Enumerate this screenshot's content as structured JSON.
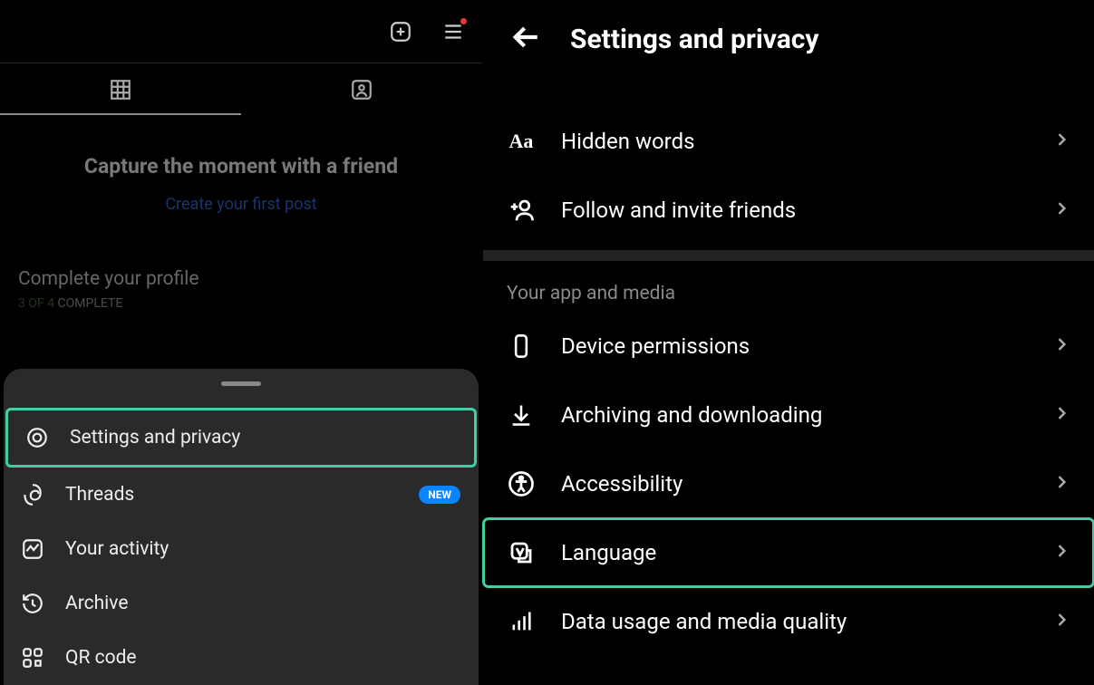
{
  "left": {
    "empty_title": "Capture the moment with a friend",
    "empty_link": "Create your first post",
    "complete_title": "Complete your profile",
    "complete_num": "3 OF 4",
    "complete_rest": " COMPLETE",
    "sheet_items": [
      {
        "label": "Settings and privacy"
      },
      {
        "label": "Threads"
      },
      {
        "label": "Your activity"
      },
      {
        "label": "Archive"
      },
      {
        "label": "QR code"
      }
    ],
    "badge_new": "NEW"
  },
  "right": {
    "header_title": "Settings and privacy",
    "top_rows": [
      {
        "label": "Hidden words"
      },
      {
        "label": "Follow and invite friends"
      }
    ],
    "section_head": "Your app and media",
    "rows": [
      {
        "label": "Device permissions"
      },
      {
        "label": "Archiving and downloading"
      },
      {
        "label": "Accessibility"
      },
      {
        "label": "Language"
      },
      {
        "label": "Data usage and media quality"
      }
    ]
  }
}
